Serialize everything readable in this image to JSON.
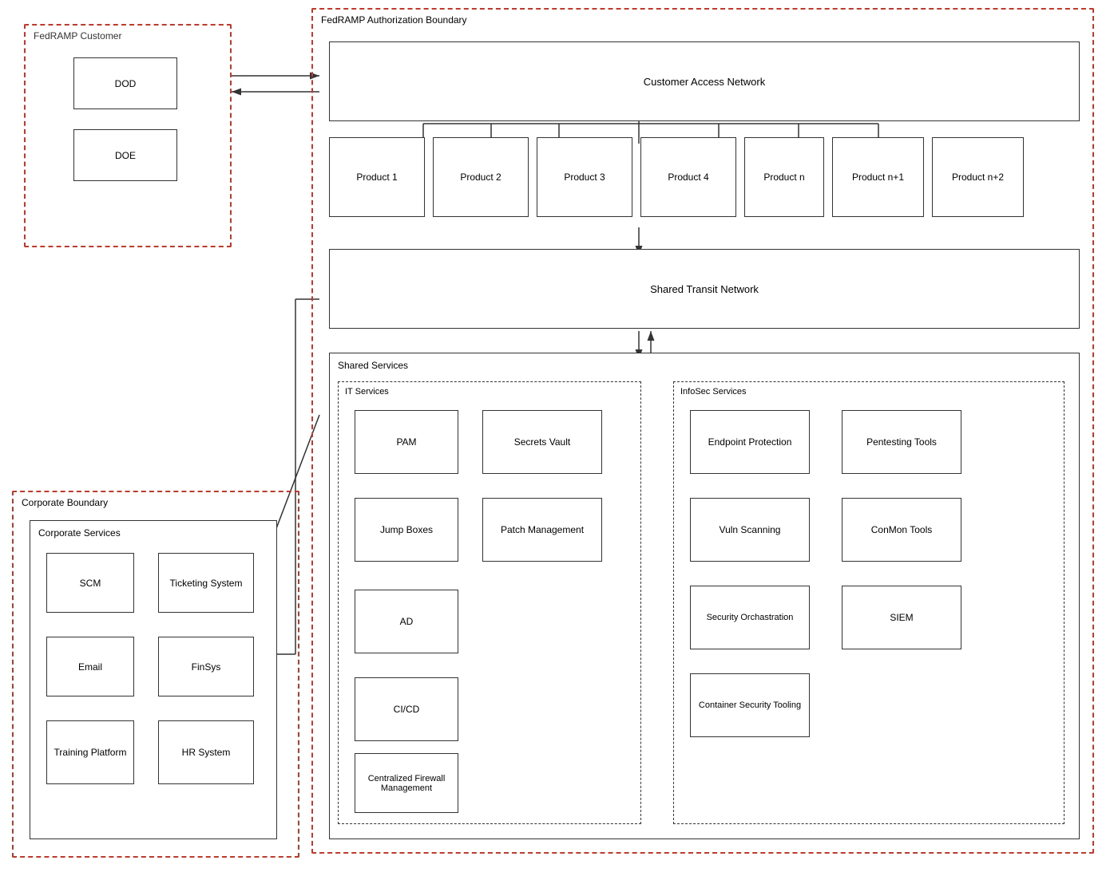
{
  "fedramp_customer": {
    "label": "FedRAMP Customer",
    "dod": "DOD",
    "doe": "DOE"
  },
  "fedramp_boundary": {
    "label": "FedRAMP Authorization Boundary",
    "customer_access_network": "Customer Access Network",
    "shared_transit_network": "Shared Transit Network",
    "shared_services": "Shared Services",
    "it_services": "IT Services",
    "infosec_services": "InfoSec Services",
    "products": [
      "Product 1",
      "Product 2",
      "Product 3",
      "Product 4",
      "Product n",
      "Product n+1",
      "Product n+2"
    ],
    "it_items": [
      "PAM",
      "Secrets Vault",
      "Jump Boxes",
      "Patch Management",
      "AD",
      "CI/CD",
      "Centralized Firewall Management"
    ],
    "infosec_items": [
      "Endpoint Protection",
      "Pentesting Tools",
      "Vuln Scanning",
      "ConMon Tools",
      "Security Orchastration",
      "SIEM",
      "Container Security Tooling"
    ]
  },
  "corporate_boundary": {
    "label": "Corporate Boundary",
    "corporate_services": "Corporate Services",
    "items": [
      "SCM",
      "Ticketing System",
      "Email",
      "FinSys",
      "Training Platform",
      "HR System"
    ]
  }
}
